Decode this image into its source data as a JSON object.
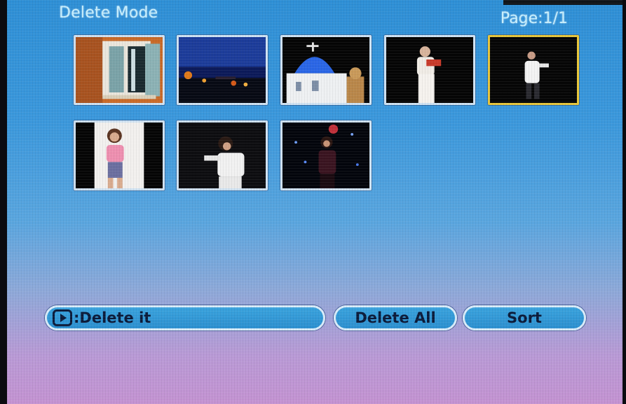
{
  "header": {
    "title": "Delete Mode",
    "page_indicator": "Page:1/1"
  },
  "thumbnails": [
    {
      "subject": "window-photo"
    },
    {
      "subject": "night-city-photo"
    },
    {
      "subject": "blue-dome-church-photo"
    },
    {
      "subject": "singer-red-top-photo"
    },
    {
      "subject": "singer-white-shirt-photo",
      "selected": true
    },
    {
      "subject": "woman-pink-top-photo"
    },
    {
      "subject": "woman-white-top-photo"
    },
    {
      "subject": "woman-dark-stage-photo"
    }
  ],
  "footer": {
    "hint_label": ":Delete it",
    "delete_all_label": "Delete All",
    "sort_label": "Sort"
  },
  "colors": {
    "highlight_border": "#e7c63a",
    "thumb_border": "#cfe2f2",
    "text": "#c8f0ff"
  }
}
